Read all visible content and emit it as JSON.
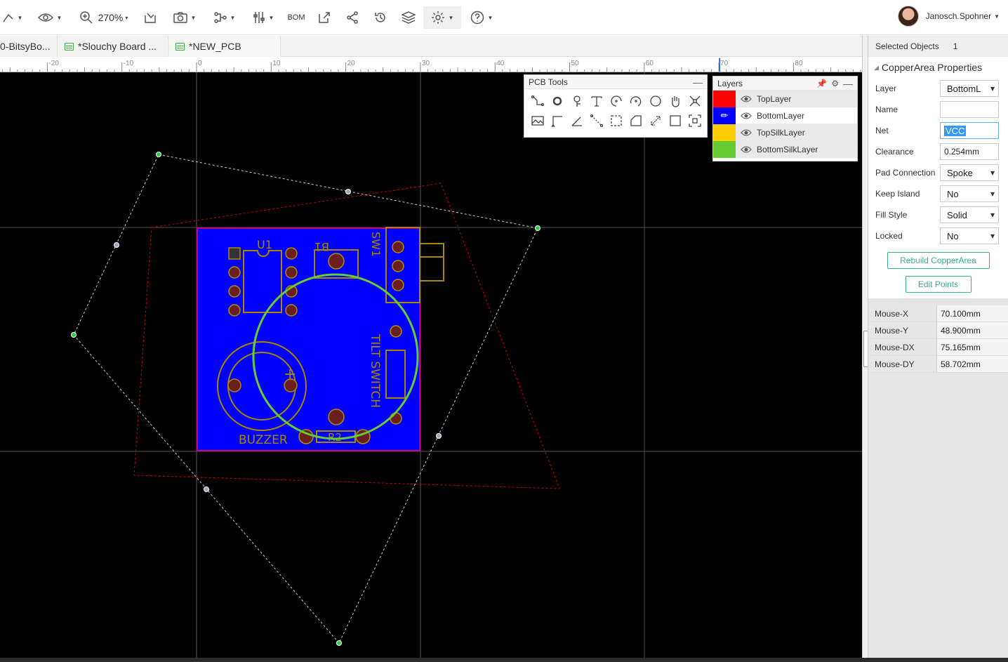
{
  "toolbar": {
    "zoom": "270%",
    "bom": "BOM",
    "user_name": "Janosch.Spohner"
  },
  "tabs": [
    {
      "label": "0-BitsyBo..."
    },
    {
      "label": "*Slouchy Board ..."
    },
    {
      "label": "*NEW_PCB"
    }
  ],
  "ruler": {
    "labels": [
      "-20",
      "-10",
      "0",
      "10",
      "20",
      "30",
      "40",
      "50",
      "60",
      "70",
      "80"
    ]
  },
  "pcb_tools": {
    "title": "PCB Tools"
  },
  "layers_panel": {
    "title": "Layers",
    "layers": [
      {
        "name": "TopLayer",
        "color": "#ff0000"
      },
      {
        "name": "BottomLayer",
        "color": "#0000ff",
        "active": true
      },
      {
        "name": "TopSilkLayer",
        "color": "#ffcc00"
      },
      {
        "name": "BottomSilkLayer",
        "color": "#66cc33"
      }
    ]
  },
  "board": {
    "labels": {
      "u1": "U1",
      "b1": "B1",
      "sw1": "SW1",
      "tilt": "TILT SWITCH",
      "buzzer": "BUZZER",
      "r2": "R2",
      "plus": "+"
    }
  },
  "properties": {
    "selected_label": "Selected Objects",
    "selected_count": "1",
    "title": "CopperArea Properties",
    "layer_label": "Layer",
    "layer_value": "BottomL",
    "name_label": "Name",
    "name_value": "",
    "net_label": "Net",
    "net_value": "VCC",
    "clearance_label": "Clearance",
    "clearance_value": "0.254mm",
    "pad_label": "Pad Connection",
    "pad_value": "Spoke",
    "island_label": "Keep Island",
    "island_value": "No",
    "fill_label": "Fill Style",
    "fill_value": "Solid",
    "locked_label": "Locked",
    "locked_value": "No",
    "rebuild_label": "Rebuild CopperArea",
    "edit_points_label": "Edit Points"
  },
  "mouse": {
    "x_label": "Mouse-X",
    "x_value": "70.100mm",
    "y_label": "Mouse-Y",
    "y_value": "48.900mm",
    "dx_label": "Mouse-DX",
    "dx_value": "75.165mm",
    "dy_label": "Mouse-DY",
    "dy_value": "58.702mm"
  }
}
